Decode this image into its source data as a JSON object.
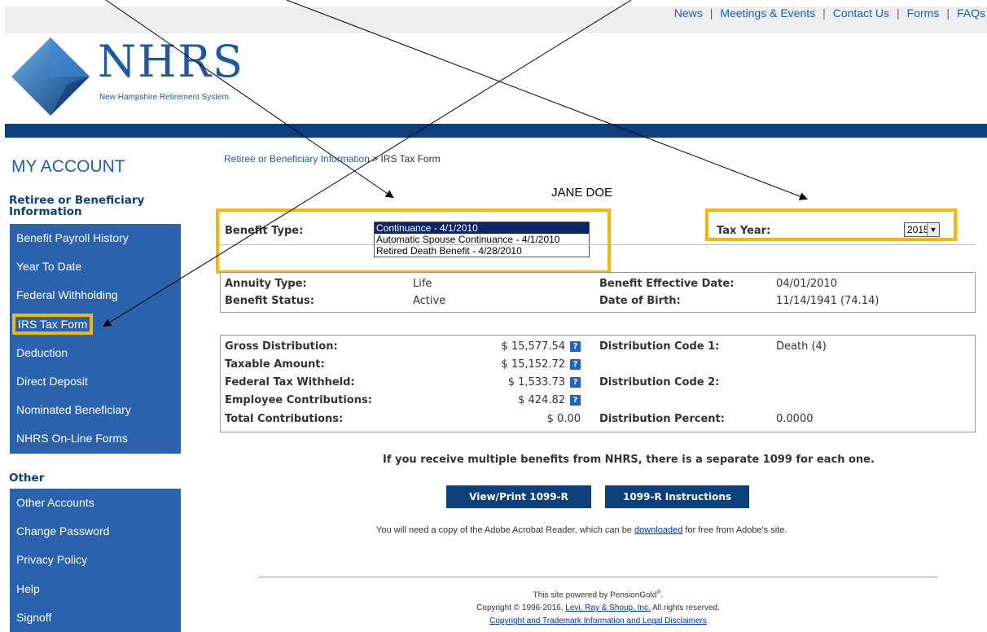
{
  "top_nav": {
    "links": [
      "News",
      "Meetings & Events",
      "Contact Us",
      "Forms",
      "FAQs"
    ],
    "separator": "|"
  },
  "logo": {
    "text": "NHRS",
    "subtitle": "New Hampshire Retirement System"
  },
  "sidebar": {
    "title": "MY ACCOUNT",
    "section1_title": "Retiree or Beneficiary Information",
    "section1_items": [
      "Benefit Payroll History",
      "Year To Date",
      "Federal Withholding",
      "IRS Tax Form",
      "Deduction",
      "Direct Deposit",
      "Nominated Beneficiary",
      "NHRS On-Line Forms"
    ],
    "section2_title": "Other",
    "section2_items": [
      "Other Accounts",
      "Change Password",
      "Privacy Policy",
      "Help",
      "Signoff"
    ]
  },
  "breadcrumb": {
    "parent": "Retiree or Beneficiary Information",
    "separator": " > ",
    "current": "IRS Tax Form"
  },
  "person_name": "JANE DOE",
  "benefit_type": {
    "label": "Benefit Type:",
    "options": [
      "Continuance - 4/1/2010",
      "Automatic Spouse Continuance - 4/1/2010",
      "Retired Death Benefit - 4/28/2010"
    ],
    "selected_index": 0
  },
  "tax_year": {
    "label": "Tax Year:",
    "value": "2015"
  },
  "info": {
    "annuity_type_label": "Annuity Type:",
    "annuity_type_value": "Life",
    "benefit_status_label": "Benefit Status:",
    "benefit_status_value": "Active",
    "effective_date_label": "Benefit Effective Date:",
    "effective_date_value": "04/01/2010",
    "dob_label": "Date of Birth:",
    "dob_value": "11/14/1941 (74.14)"
  },
  "distribution": {
    "gross_label": "Gross Distribution:",
    "gross_value": "$ 15,577.54",
    "taxable_label": "Taxable Amount:",
    "taxable_value": "$ 15,152.72",
    "fed_tax_label": "Federal Tax Withheld:",
    "fed_tax_value": "$ 1,533.73",
    "employee_contrib_label": "Employee Contributions:",
    "employee_contrib_value": "$ 424.82",
    "total_contrib_label": "Total Contributions:",
    "total_contrib_value": "$ 0.00",
    "code1_label": "Distribution Code 1:",
    "code1_value": "Death (4)",
    "code2_label": "Distribution Code 2:",
    "code2_value": "",
    "percent_label": "Distribution Percent:",
    "percent_value": "0.0000",
    "help_glyph": "?"
  },
  "notice": "If you receive multiple benefits from NHRS, there is a separate 1099 for each one.",
  "buttons": {
    "view_print": "View/Print 1099-R",
    "instructions": "1099-R Instructions"
  },
  "acrobat": {
    "before": "You will need a copy of the Adobe Acrobat Reader, which can be ",
    "link": "downloaded",
    "after": " for free from Adobe's site."
  },
  "footer": {
    "powered": "This site powered by PensionGold",
    "reg_mark": "®",
    "period": ".",
    "copyright_before": "Copyright © 1996-2016, ",
    "company_link": "Levi, Ray & Shoup, Inc.",
    "copyright_after": " All rights reserved.",
    "legal_link": "Copyright and Trademark Information and Legal Disclaimers"
  },
  "colors": {
    "brand_blue": "#0d3f7c",
    "menu_blue": "#2a62ad",
    "highlight_yellow": "#f5b800",
    "link_blue": "#1f5fa8"
  }
}
